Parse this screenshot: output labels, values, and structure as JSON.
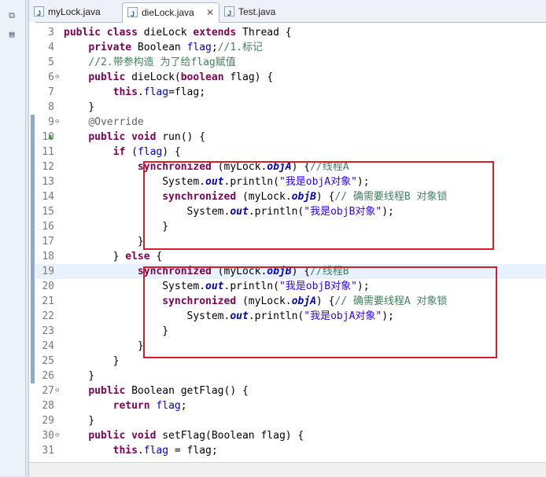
{
  "tabs": [
    {
      "label": "myLock.java",
      "active": false
    },
    {
      "label": "dieLock.java",
      "active": true
    },
    {
      "label": "Test.java",
      "active": false
    }
  ],
  "left_icons": [
    "restore-icon",
    "outline-icon"
  ],
  "lines": [
    {
      "n": "3",
      "fold": "",
      "cur": false,
      "html": "<span class='kw'>public class</span> dieLock <span class='kw'>extends</span> Thread {"
    },
    {
      "n": "4",
      "fold": "",
      "cur": false,
      "html": "    <span class='kw'>private</span> Boolean <span class='fd'>flag</span>;<span class='cm'>//1.标记</span>"
    },
    {
      "n": "5",
      "fold": "",
      "cur": false,
      "html": "    <span class='cm'>//2.带参构造 为了给flag赋值</span>"
    },
    {
      "n": "6",
      "fold": "⊖",
      "cur": false,
      "html": "    <span class='kw'>public</span> dieLock(<span class='kw'>boolean</span> flag) {"
    },
    {
      "n": "7",
      "fold": "",
      "cur": false,
      "html": "        <span class='kw'>this</span>.<span class='fd'>flag</span>=flag;"
    },
    {
      "n": "8",
      "fold": "",
      "cur": false,
      "html": "    }"
    },
    {
      "n": "9",
      "fold": "⊖",
      "cur": false,
      "html": "    <span class='an'>@Override</span>"
    },
    {
      "n": "10",
      "fold": "",
      "cur": false,
      "html": "    <span class='kw'>public void</span> run() {"
    },
    {
      "n": "11",
      "fold": "",
      "cur": false,
      "html": "        <span class='kw'>if</span> (<span class='fd'>flag</span>) {"
    },
    {
      "n": "12",
      "fold": "",
      "cur": false,
      "html": "            <span class='kw'>synchronized</span> (myLock.<span class='sf'>objA</span>) {<span class='cm'>//线程A</span>"
    },
    {
      "n": "13",
      "fold": "",
      "cur": false,
      "html": "                System.<span class='sf'>out</span>.println(<span class='st'>\"我是objA对象\"</span>);"
    },
    {
      "n": "14",
      "fold": "",
      "cur": false,
      "html": "                <span class='kw'>synchronized</span> (myLock.<span class='sf'>objB</span>) {<span class='cm'>// 确需要线程B 对象锁</span>"
    },
    {
      "n": "15",
      "fold": "",
      "cur": false,
      "html": "                    System.<span class='sf'>out</span>.println(<span class='st'>\"我是objB对象\"</span>);"
    },
    {
      "n": "16",
      "fold": "",
      "cur": false,
      "html": "                }"
    },
    {
      "n": "17",
      "fold": "",
      "cur": false,
      "html": "            }"
    },
    {
      "n": "18",
      "fold": "",
      "cur": false,
      "html": "        } <span class='kw'>else</span> {"
    },
    {
      "n": "19",
      "fold": "",
      "cur": true,
      "html": "            <span class='kw'>synchronized</span> (myLock.<span class='sf'>objB</span>) {<span class='cm'>//线程B</span>"
    },
    {
      "n": "20",
      "fold": "",
      "cur": false,
      "html": "                System.<span class='sf'>out</span>.println(<span class='st'>\"我是objB对象\"</span>);"
    },
    {
      "n": "21",
      "fold": "",
      "cur": false,
      "html": "                <span class='kw'>synchronized</span> (myLock.<span class='sf'>objA</span>) {<span class='cm'>// 确需要线程A 对象锁</span>"
    },
    {
      "n": "22",
      "fold": "",
      "cur": false,
      "html": "                    System.<span class='sf'>out</span>.println(<span class='st'>\"我是objA对象\"</span>);"
    },
    {
      "n": "23",
      "fold": "",
      "cur": false,
      "html": "                }"
    },
    {
      "n": "24",
      "fold": "",
      "cur": false,
      "html": "            }"
    },
    {
      "n": "25",
      "fold": "",
      "cur": false,
      "html": "        }"
    },
    {
      "n": "26",
      "fold": "",
      "cur": false,
      "html": "    }"
    },
    {
      "n": "27",
      "fold": "⊖",
      "cur": false,
      "html": "    <span class='kw'>public</span> Boolean getFlag() {"
    },
    {
      "n": "28",
      "fold": "",
      "cur": false,
      "html": "        <span class='kw'>return</span> <span class='fd'>flag</span>;"
    },
    {
      "n": "29",
      "fold": "",
      "cur": false,
      "html": "    }"
    },
    {
      "n": "30",
      "fold": "⊖",
      "cur": false,
      "html": "    <span class='kw'>public void</span> setFlag(Boolean flag) {"
    },
    {
      "n": "31",
      "fold": "",
      "cur": false,
      "html": "        <span class='kw'>this</span>.<span class='fd'>flag</span> = flag;"
    }
  ]
}
